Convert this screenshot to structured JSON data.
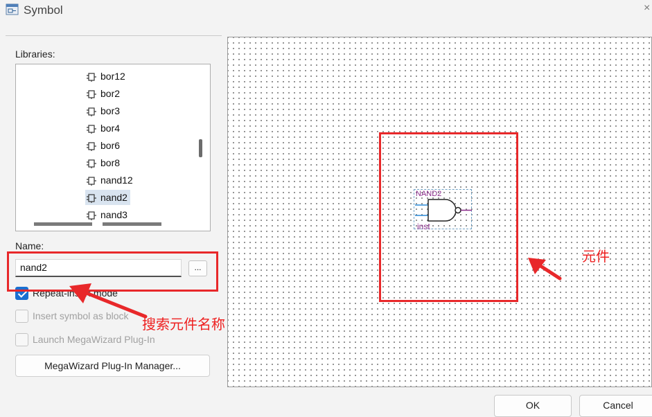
{
  "window": {
    "title": "Symbol",
    "close_glyph": "×",
    "icon": "symbol-app-icon"
  },
  "libraries": {
    "label": "Libraries:",
    "items": [
      {
        "label": "bor12",
        "icon": "symbol-icon"
      },
      {
        "label": "bor2",
        "icon": "symbol-icon"
      },
      {
        "label": "bor3",
        "icon": "symbol-icon"
      },
      {
        "label": "bor4",
        "icon": "symbol-icon"
      },
      {
        "label": "bor6",
        "icon": "symbol-icon"
      },
      {
        "label": "bor8",
        "icon": "symbol-icon"
      },
      {
        "label": "nand12",
        "icon": "symbol-icon"
      },
      {
        "label": "nand2",
        "icon": "symbol-icon",
        "selected": true
      },
      {
        "label": "nand3",
        "icon": "symbol-icon"
      }
    ]
  },
  "name_field": {
    "label": "Name:",
    "value": "nand2",
    "browse_label": "..."
  },
  "options": {
    "repeat_insert": {
      "label": "Repeat-insert mode",
      "checked": true
    },
    "insert_as_block": {
      "label": "Insert symbol as block",
      "checked": false,
      "disabled": true
    },
    "launch_megawizard": {
      "label": "Launch MegaWizard Plug-In",
      "checked": false,
      "disabled": true
    }
  },
  "megawizard_button": {
    "label": "MegaWizard Plug-In Manager..."
  },
  "preview": {
    "symbol_name": "NAND2",
    "instance_label": "inst"
  },
  "annotations": {
    "search_label": "搜索元件名称",
    "component_label": "元件",
    "color": "#e8282a"
  },
  "footer": {
    "ok_label": "OK",
    "cancel_label": "Cancel"
  },
  "colors": {
    "accent": "#1a6fd1",
    "selection": "#d9e4f0",
    "symbol_text": "#8a2b8a"
  }
}
